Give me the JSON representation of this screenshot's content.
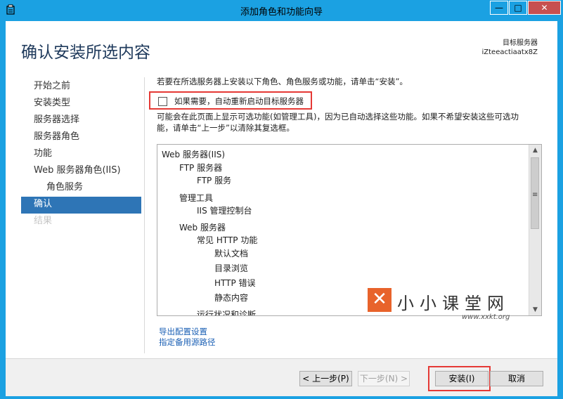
{
  "window": {
    "title": "添加角色和功能向导",
    "controls": {
      "minimize": "—",
      "maximize": "□",
      "close": "✕"
    }
  },
  "header": {
    "page_title": "确认安装所选内容",
    "target_server_label": "目标服务器",
    "target_server_name": "iZteeactiaatx8Z"
  },
  "nav": [
    {
      "label": "开始之前",
      "state": "normal"
    },
    {
      "label": "安装类型",
      "state": "normal"
    },
    {
      "label": "服务器选择",
      "state": "normal"
    },
    {
      "label": "服务器角色",
      "state": "normal"
    },
    {
      "label": "功能",
      "state": "normal"
    },
    {
      "label": "Web 服务器角色(IIS)",
      "state": "normal"
    },
    {
      "label": "角色服务",
      "state": "sub"
    },
    {
      "label": "确认",
      "state": "active"
    },
    {
      "label": "结果",
      "state": "disabled"
    }
  ],
  "main": {
    "intro": "若要在所选服务器上安装以下角色、角色服务或功能，请单击“安装”。",
    "restart_checkbox": {
      "label": "如果需要，自动重新启动目标服务器",
      "checked": false
    },
    "description_line1": "可能会在此页面上显示可选功能(如管理工具)，因为已自动选择这些功能。如果不希望安装这些可选功",
    "description_line2": "能，请单击“上一步”以清除其复选框。",
    "tree": [
      {
        "label": "Web 服务器(IIS)",
        "level": 0
      },
      {
        "label": "FTP 服务器",
        "level": 1
      },
      {
        "label": "FTP 服务",
        "level": 2
      },
      {
        "label": "管理工具",
        "level": 1
      },
      {
        "label": "IIS 管理控制台",
        "level": 2
      },
      {
        "label": "Web 服务器",
        "level": 1
      },
      {
        "label": "常见 HTTP 功能",
        "level": 2
      },
      {
        "label": "默认文档",
        "level": 3
      },
      {
        "label": "目录浏览",
        "level": 3
      },
      {
        "label": "HTTP 错误",
        "level": 3
      },
      {
        "label": "静态内容",
        "level": 3
      },
      {
        "label": "运行状况和诊断",
        "level": 2
      }
    ],
    "links": {
      "export": "导出配置设置",
      "alternate_source": "指定备用源路径"
    }
  },
  "watermark": {
    "logo_glyph": "✕",
    "text": "小小课堂网",
    "url": "www.xxkt.org"
  },
  "footer": {
    "prev": "< 上一步(P)",
    "next": "下一步(N) >",
    "install": "安装(I)",
    "cancel": "取消"
  },
  "colors": {
    "accent": "#1ba1e2",
    "nav_active": "#2e75b6",
    "highlight_box": "#e53935",
    "title_text": "#1e395b"
  }
}
